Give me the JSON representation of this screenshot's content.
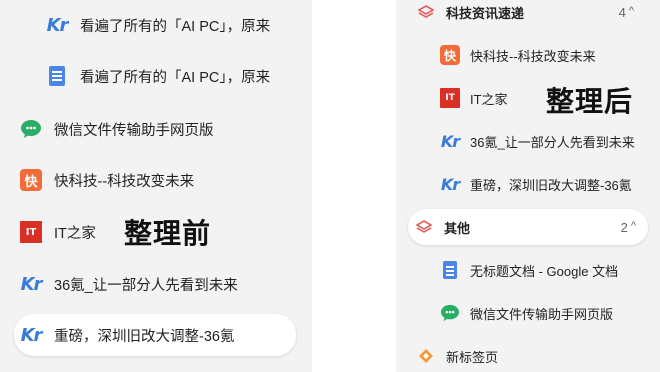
{
  "left": {
    "caption": "整理前",
    "items": [
      {
        "icon": "kr-icon",
        "label": "看遍了所有的「AI PC」，原来"
      },
      {
        "icon": "doc-icon",
        "label": "看遍了所有的「AI PC」，原来"
      },
      {
        "icon": "wechat-icon",
        "label": "微信文件传输助手网页版"
      },
      {
        "icon": "kuai-icon",
        "label": "快科技--科技改变未来"
      },
      {
        "icon": "ithome-icon",
        "label": "IT之家"
      },
      {
        "icon": "kr-icon",
        "label": "36氪_让一部分人先看到未来"
      },
      {
        "icon": "kr-icon",
        "label": "重磅，深圳旧改大调整-36氪"
      }
    ]
  },
  "right": {
    "caption": "整理后",
    "group1": {
      "label": "科技资讯速递",
      "count": "4"
    },
    "group1_items": [
      {
        "icon": "kuai-icon",
        "label": "快科技--科技改变未来"
      },
      {
        "icon": "ithome-icon",
        "label": "IT之家"
      },
      {
        "icon": "kr-icon",
        "label": "36氪_让一部分人先看到未来"
      },
      {
        "icon": "kr-icon",
        "label": "重磅，深圳旧改大调整-36氪"
      }
    ],
    "group2": {
      "label": "其他",
      "count": "2"
    },
    "group2_items": [
      {
        "icon": "doc-icon",
        "label": "无标题文档 - Google 文档"
      },
      {
        "icon": "wechat-icon",
        "label": "微信文件传输助手网页版"
      }
    ],
    "new_tab": {
      "icon": "new-tab-icon",
      "label": "新标签页"
    }
  },
  "glyphs": {
    "kr": "Kr",
    "it": "IT",
    "kuai": "快",
    "chevron_up": "^"
  }
}
